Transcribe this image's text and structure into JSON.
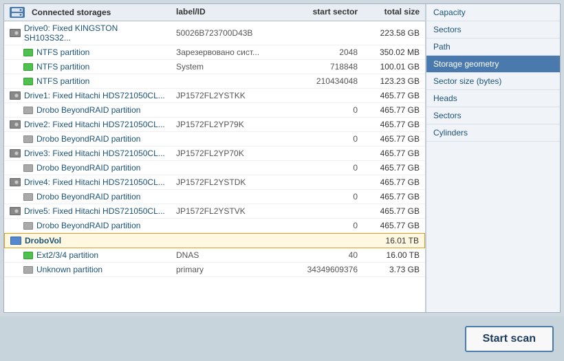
{
  "header": {
    "title": "Connected storages",
    "col_label": "label/ID",
    "col_start": "start sector",
    "col_size": "total size"
  },
  "rows": [
    {
      "id": "drive0",
      "indent": false,
      "type": "drive",
      "name": "Drive0: Fixed KINGSTON SH103S32...",
      "label": "50026B723700D43B",
      "start": "",
      "size": "223.58 GB"
    },
    {
      "id": "ntfs1",
      "indent": true,
      "type": "partition-green",
      "name": "NTFS partition",
      "label": "Зарезервовано сист...",
      "start": "2048",
      "size": "350.02 MB"
    },
    {
      "id": "ntfs2",
      "indent": true,
      "type": "partition-green",
      "name": "NTFS partition",
      "label": "System",
      "start": "718848",
      "size": "100.01 GB"
    },
    {
      "id": "ntfs3",
      "indent": true,
      "type": "partition-green",
      "name": "NTFS partition",
      "label": "",
      "start": "210434048",
      "size": "123.23 GB"
    },
    {
      "id": "drive1",
      "indent": false,
      "type": "drive",
      "name": "Drive1: Fixed Hitachi HDS721050CL...",
      "label": "JP1572FL2YSTKK",
      "start": "",
      "size": "465.77 GB"
    },
    {
      "id": "drobo1",
      "indent": true,
      "type": "partition-grey",
      "name": "Drobo BeyondRAID partition",
      "label": "",
      "start": "0",
      "size": "465.77 GB"
    },
    {
      "id": "drive2",
      "indent": false,
      "type": "drive",
      "name": "Drive2: Fixed Hitachi HDS721050CL...",
      "label": "JP1572FL2YP79K",
      "start": "",
      "size": "465.77 GB"
    },
    {
      "id": "drobo2",
      "indent": true,
      "type": "partition-grey",
      "name": "Drobo BeyondRAID partition",
      "label": "",
      "start": "0",
      "size": "465.77 GB"
    },
    {
      "id": "drive3",
      "indent": false,
      "type": "drive",
      "name": "Drive3: Fixed Hitachi HDS721050CL...",
      "label": "JP1572FL2YP70K",
      "start": "",
      "size": "465.77 GB"
    },
    {
      "id": "drobo3",
      "indent": true,
      "type": "partition-grey",
      "name": "Drobo BeyondRAID partition",
      "label": "",
      "start": "0",
      "size": "465.77 GB"
    },
    {
      "id": "drive4",
      "indent": false,
      "type": "drive",
      "name": "Drive4: Fixed Hitachi HDS721050CL...",
      "label": "JP1572FL2YSTDK",
      "start": "",
      "size": "465.77 GB"
    },
    {
      "id": "drobo4",
      "indent": true,
      "type": "partition-grey",
      "name": "Drobo BeyondRAID partition",
      "label": "",
      "start": "0",
      "size": "465.77 GB"
    },
    {
      "id": "drive5",
      "indent": false,
      "type": "drive",
      "name": "Drive5: Fixed Hitachi HDS721050CL...",
      "label": "JP1572FL2YSTVK",
      "start": "",
      "size": "465.77 GB"
    },
    {
      "id": "drobo5",
      "indent": true,
      "type": "partition-grey",
      "name": "Drobo BeyondRAID partition",
      "label": "",
      "start": "0",
      "size": "465.77 GB"
    },
    {
      "id": "drobovol",
      "indent": false,
      "type": "volume",
      "name": "DroboVol",
      "label": "",
      "start": "",
      "size": "16.01 TB",
      "selected": true
    },
    {
      "id": "ext",
      "indent": true,
      "type": "partition-green",
      "name": "Ext2/3/4 partition",
      "label": "DNAS",
      "start": "40",
      "size": "16.00 TB"
    },
    {
      "id": "unknown",
      "indent": true,
      "type": "partition-grey",
      "name": "Unknown partition",
      "label": "primary",
      "start": "34349609376",
      "size": "3.73 GB"
    }
  ],
  "right_panel": {
    "items": [
      {
        "id": "capacity",
        "label": "Capacity",
        "active": false
      },
      {
        "id": "sectors",
        "label": "Sectors",
        "active": false
      },
      {
        "id": "path",
        "label": "Path",
        "active": false
      },
      {
        "id": "storage-geometry",
        "label": "Storage geometry",
        "active": true,
        "section": true
      },
      {
        "id": "sector-size",
        "label": "Sector size (bytes)",
        "active": false
      },
      {
        "id": "heads",
        "label": "Heads",
        "active": false
      },
      {
        "id": "sectors2",
        "label": "Sectors",
        "active": false
      },
      {
        "id": "cylinders",
        "label": "Cylinders",
        "active": false
      }
    ]
  },
  "footer": {
    "start_scan_label": "Start scan"
  }
}
